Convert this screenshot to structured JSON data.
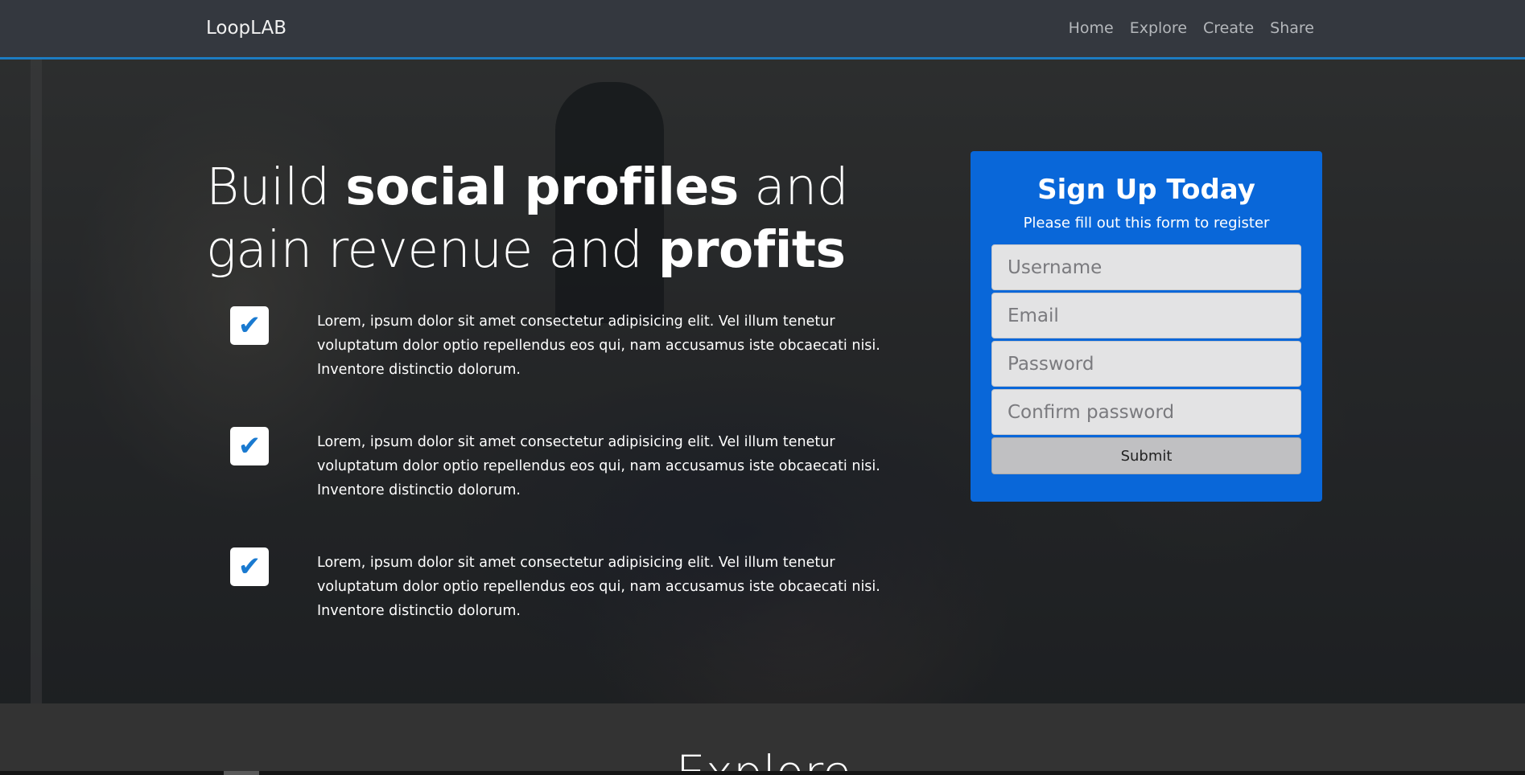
{
  "nav": {
    "brand": "LoopLAB",
    "links": [
      "Home",
      "Explore",
      "Create",
      "Share"
    ]
  },
  "hero": {
    "headline": {
      "part1": "Build ",
      "bold1": "social profiles",
      "part2": " and gain revenue and ",
      "bold2": "profits"
    },
    "features": [
      {
        "icon": "check-icon",
        "text": "Lorem, ipsum dolor sit amet consectetur adipisicing elit. Vel illum tenetur voluptatum dolor optio repellendus eos qui, nam accusamus iste obcaecati nisi. Inventore distinctio dolorum."
      },
      {
        "icon": "check-icon",
        "text": "Lorem, ipsum dolor sit amet consectetur adipisicing elit. Vel illum tenetur voluptatum dolor optio repellendus eos qui, nam accusamus iste obcaecati nisi. Inventore distinctio dolorum."
      },
      {
        "icon": "check-icon",
        "text": "Lorem, ipsum dolor sit amet consectetur adipisicing elit. Vel illum tenetur voluptatum dolor optio repellendus eos qui, nam accusamus iste obcaecati nisi. Inventore distinctio dolorum."
      }
    ]
  },
  "signup": {
    "title": "Sign Up Today",
    "subtitle": "Please fill out this form to register",
    "fields": {
      "username_placeholder": "Username",
      "email_placeholder": "Email",
      "password_placeholder": "Password",
      "confirm_placeholder": "Confirm password"
    },
    "submit_label": "Submit"
  },
  "bottom": {
    "heading_partial": "Explore"
  },
  "colors": {
    "accent": "#1c7cc2",
    "card": "#0967d9",
    "navbar": "#34383f",
    "check": "#1a7ad0"
  }
}
